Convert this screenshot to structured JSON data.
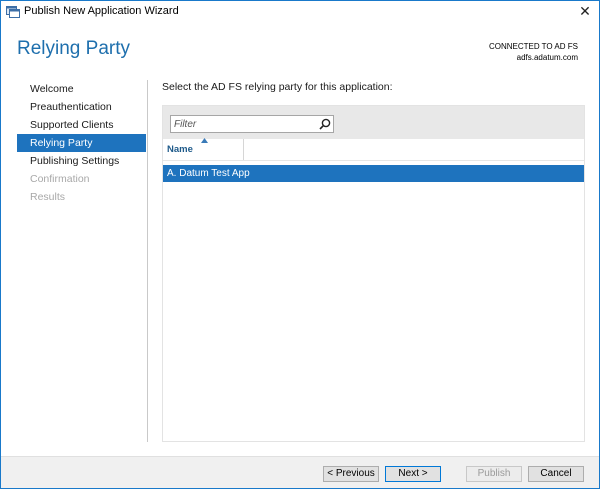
{
  "window": {
    "title": "Publish New Application Wizard",
    "close_glyph": "✕"
  },
  "header": {
    "title": "Relying Party",
    "connection_status": "CONNECTED TO AD FS",
    "connection_server": "adfs.adatum.com"
  },
  "nav": {
    "items": [
      {
        "label": "Welcome",
        "state": "normal"
      },
      {
        "label": "Preauthentication",
        "state": "normal"
      },
      {
        "label": "Supported Clients",
        "state": "normal"
      },
      {
        "label": "Relying Party",
        "state": "active"
      },
      {
        "label": "Publishing Settings",
        "state": "normal"
      },
      {
        "label": "Confirmation",
        "state": "disabled"
      },
      {
        "label": "Results",
        "state": "disabled"
      }
    ]
  },
  "main": {
    "prompt": "Select the AD FS relying party for this application:",
    "filter": {
      "placeholder": "Filter",
      "value": ""
    },
    "column_header": "Name",
    "rows": [
      "A. Datum Test App"
    ]
  },
  "footer": {
    "previous_label": "< Previous",
    "next_label": "Next >",
    "publish_label": "Publish",
    "cancel_label": "Cancel"
  },
  "colors": {
    "accent": "#1e73be",
    "header_title": "#1e6fad",
    "disabled_text": "#a8a8a8"
  }
}
